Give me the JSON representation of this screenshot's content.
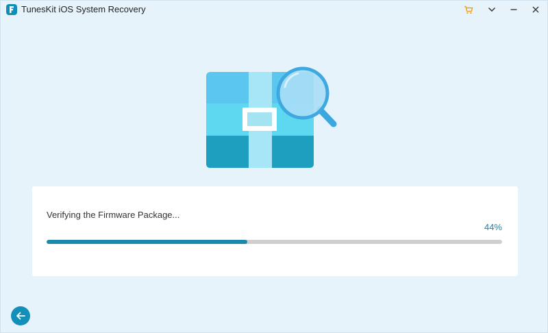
{
  "window": {
    "title": "TunesKit iOS System Recovery",
    "controls": [
      "cart-icon",
      "chevron-down-icon",
      "minimize-icon",
      "close-icon"
    ]
  },
  "illustration": {
    "icon": "firmware-package-magnifier-icon"
  },
  "progress": {
    "status": "Verifying the Firmware Package...",
    "percent_label": "44%",
    "value": 0.44
  },
  "footer": {
    "back_icon": "back-arrow-icon"
  },
  "colors": {
    "accent": "#1a89ac",
    "background": "#e6f3fb",
    "cart": "#f0a01a"
  }
}
